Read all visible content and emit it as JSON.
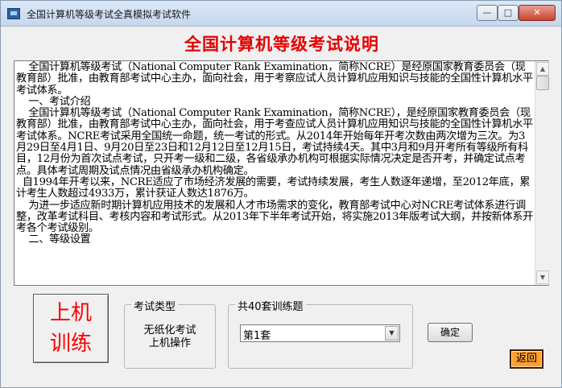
{
  "window": {
    "title": "全国计算机等级考试全真模拟考试软件",
    "minimize_glyph": "—",
    "maximize_glyph": "□",
    "close_glyph": "✕"
  },
  "heading": "全国计算机等级考试说明",
  "description": {
    "paragraphs": [
      "    全国计算机等级考试（National Computer Rank Examination，简称NCRE）是经原国家教育委员会（现教育部）批准，由教育部考试中心主办，面向社会，用于考察应试人员计算机应用知识与技能的全国性计算机水平考试体系。",
      "    一、考试介绍",
      "    全国计算机等级考试（National Computer Rank Examination，简称NCRE），是经原国家教育委员会（现教育部）批准，由教育部考试中心主办，面向社会，用于考查应试人员计算机应用知识与技能的全国性计算机水平考试体系。NCRE考试采用全国统一命题，统一考试的形式。从2014年开始每年开考次数由两次增为三次。为3月29日至4月1日、9月20日至23日和12月12日至12月15日，考试持续4天。其中3月和9月开考所有等级所有科目，12月份为首次试点考试，只开考一级和二级，各省级承办机构可根据实际情况决定是否开考，并确定试点考点。具体考试周期及试点情况由省级承办机构确定。",
      "  自1994年开考以来，NCRE适应了市场经济发展的需要，考试持续发展，考生人数逐年递增，至2012年底，累计考生人数超过4933万，累计获证人数达1876万。",
      "    为进一步适应新时期计算机应用技术的发展和人才市场需求的变化，教育部考试中心对NCRE考试体系进行调整，改革考试科目、考核内容和考试形式。从2013年下半年考试开始，将实施2013年版考试大纲，并按新体系开考各个考试级别。",
      "    二、等级设置"
    ]
  },
  "train_button": {
    "line1": "上机",
    "line2": "训练"
  },
  "exam_type_group": {
    "legend": "考试类型",
    "line1": "无纸化考试",
    "line2": "上机操作"
  },
  "sets_group": {
    "legend": "共40套训练题",
    "selected": "第1套"
  },
  "confirm_label": "确定",
  "back_label": "返回",
  "colors": {
    "heading": "#e60000",
    "train_text": "#ff0000",
    "back_button": "#ff9f2e"
  }
}
